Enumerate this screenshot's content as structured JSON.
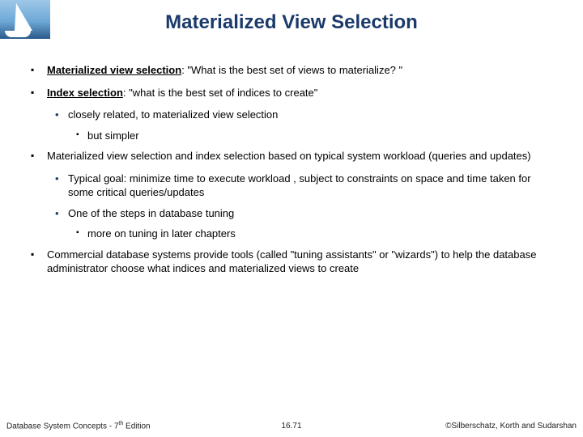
{
  "title": "Materialized View Selection",
  "bullets": {
    "b1_strong": "Materialized view selection",
    "b1_rest": ": \"What is the best set of views to materialize? \"",
    "b2_strong": "Index selection",
    "b2_rest": ":  \"what is the best set of indices to create\"",
    "b2_1": "closely related, to materialized view selection",
    "b2_1_1": "but simpler",
    "b3": "Materialized view selection and index selection based on typical system workload (queries and updates)",
    "b3_1": "Typical goal: minimize time to execute workload , subject to constraints on space and time taken for some critical queries/updates",
    "b3_2": "One of the steps in database tuning",
    "b3_2_1": "more on tuning in later chapters",
    "b4": "Commercial database systems provide tools (called \"tuning assistants\" or \"wizards\") to help the database administrator choose what indices and materialized views to create"
  },
  "footer": {
    "left_a": "Database System Concepts - 7",
    "left_b": " Edition",
    "center": "16.71",
    "right": "©Silberschatz, Korth and Sudarshan"
  }
}
